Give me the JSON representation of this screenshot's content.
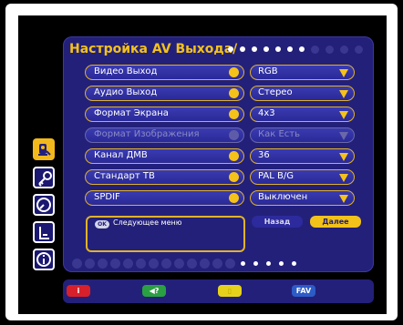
{
  "title": "Настройка AV Выхода/",
  "settings": [
    {
      "label": "Видео Выход",
      "value": "RGB",
      "disabled": false
    },
    {
      "label": "Аудио Выход",
      "value": "Стерео",
      "disabled": false
    },
    {
      "label": "Формат Экрана",
      "value": "4x3",
      "disabled": false
    },
    {
      "label": "Формат Изображения",
      "value": "Как Есть",
      "disabled": true
    },
    {
      "label": "Канал ДМВ",
      "value": "36",
      "disabled": false
    },
    {
      "label": "Стандарт ТВ",
      "value": "PAL B/G",
      "disabled": false
    },
    {
      "label": "SPDIF",
      "value": "Выключен",
      "disabled": false
    }
  ],
  "info": {
    "ok_badge": "OK",
    "text": "Следующее меню"
  },
  "buttons": {
    "back": "Назад",
    "next": "Далее"
  },
  "side_icons": [
    "satellite-icon",
    "key-icon",
    "clock-icon",
    "film-icon",
    "info-icon"
  ],
  "color_keys": {
    "red": "i",
    "green": "◀?",
    "yellow": "▯",
    "blue": "FAV"
  },
  "colors": {
    "panel": "#23207a",
    "accent": "#f5c21a",
    "pill": "#2f2fa6"
  }
}
